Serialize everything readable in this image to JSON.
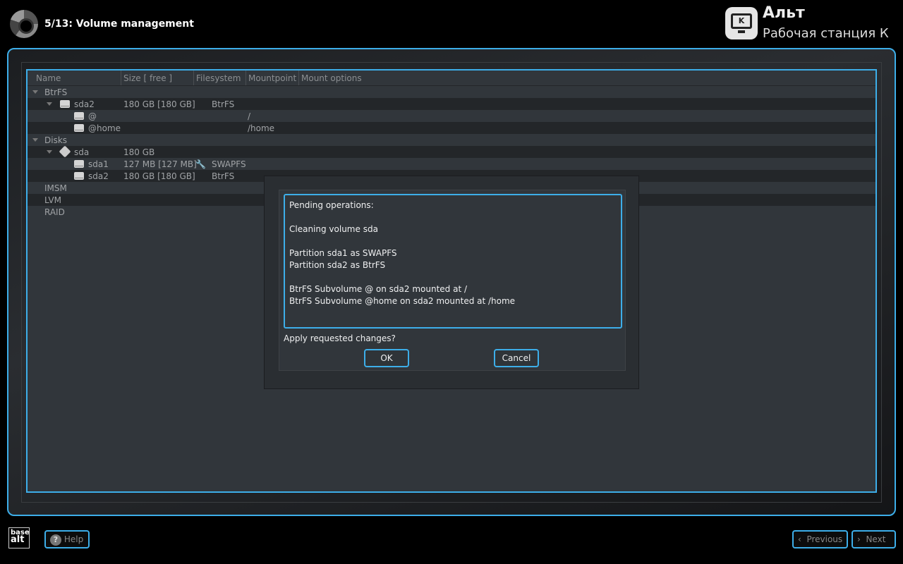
{
  "header": {
    "title": "5/13: Volume management",
    "brand_name": "Альт",
    "brand_product": "Рабочая станция К",
    "brand_icon_letter": "K"
  },
  "table": {
    "columns": [
      "Name",
      "Size [ free ]",
      "Filesystem",
      "Mountpoint",
      "Mount options"
    ],
    "rows": [
      {
        "name": "BtrFS",
        "level": 0,
        "expander": true
      },
      {
        "name": "sda2",
        "level": 1,
        "expander": true,
        "icon": "drive",
        "size": "180 GB [180 GB]",
        "fs": "BtrFS"
      },
      {
        "name": "@",
        "level": 2,
        "icon": "drive",
        "mount": "/"
      },
      {
        "name": "@home",
        "level": 2,
        "icon": "drive",
        "mount": "/home"
      },
      {
        "name": "Disks",
        "level": 0,
        "expander": true
      },
      {
        "name": "sda",
        "level": 1,
        "expander": true,
        "icon": "hdd",
        "size": "180 GB"
      },
      {
        "name": "sda1",
        "level": 2,
        "icon": "drive",
        "size": "127 MB [127 MB]",
        "fs": "SWAPFS",
        "wrench": true
      },
      {
        "name": "sda2",
        "level": 2,
        "icon": "drive",
        "size": "180 GB [180 GB]",
        "fs": "BtrFS"
      },
      {
        "name": "IMSM",
        "level": 0
      },
      {
        "name": "LVM",
        "level": 0
      },
      {
        "name": "RAID",
        "level": 0
      }
    ]
  },
  "dialog": {
    "text": "Pending operations:\n\nCleaning volume sda\n\nPartition sda1 as SWAPFS\nPartition sda2 as BtrFS\n\nBtrFS Subvolume @ on sda2 mounted at /\nBtrFS Subvolume @home on sda2 mounted at /home",
    "question": "Apply requested changes?",
    "ok": "OK",
    "cancel": "Cancel"
  },
  "footer": {
    "logo_top": "base",
    "logo_bottom": "alt",
    "help": "Help",
    "previous": "Previous",
    "next": "Next"
  },
  "colors": {
    "accent": "#3daee9"
  }
}
